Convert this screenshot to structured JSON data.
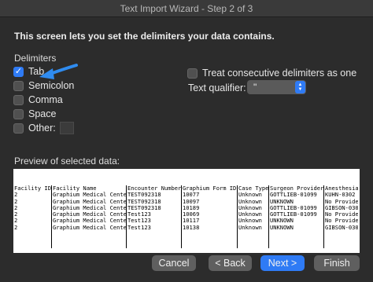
{
  "window": {
    "title": "Text Import Wizard - Step 2 of 3"
  },
  "instructions": "This screen lets you set the delimiters your data contains.",
  "delimiters": {
    "label": "Delimiters",
    "tab": {
      "label": "Tab",
      "checked": true
    },
    "semicolon": {
      "label": "Semicolon",
      "checked": false
    },
    "comma": {
      "label": "Comma",
      "checked": false
    },
    "space": {
      "label": "Space",
      "checked": false
    },
    "other": {
      "label": "Other:",
      "checked": false,
      "value": ""
    }
  },
  "options": {
    "consecutive": {
      "label": "Treat consecutive delimiters as one",
      "checked": false
    },
    "qualifier_label": "Text qualifier:",
    "qualifier_value": "\""
  },
  "preview": {
    "label": "Preview of selected data:",
    "columns": [
      {
        "cells": [
          "Facility ID",
          "2",
          "2",
          "2",
          "2",
          "2",
          "2"
        ]
      },
      {
        "cells": [
          "Facility Name",
          "Graphium Medical Center",
          "Graphium Medical Center",
          "Graphium Medical Center",
          "Graphium Medical Center",
          "Graphium Medical Center",
          "Graphium Medical Center"
        ]
      },
      {
        "cells": [
          "Encounter Number",
          "TEST092318",
          "TEST092318",
          "TEST092318",
          "Test123",
          "Test123",
          "Test123"
        ]
      },
      {
        "cells": [
          "Graphium Form ID",
          "10077",
          "10097",
          "10189",
          "10069",
          "10117",
          "10138"
        ]
      },
      {
        "cells": [
          "Case Type",
          "Unknown",
          "Unknown",
          "Unknown",
          "Unknown",
          "Unknown",
          "Unknown"
        ]
      },
      {
        "cells": [
          "Surgeon Provider",
          "GOTTLIEB-01099",
          "UNKNOWN",
          "GOTTLIEB-01099",
          "GOTTLIEB-01099",
          "UNKNOWN",
          "UNKNOWN"
        ]
      },
      {
        "cells": [
          "Anesthesia",
          "KUHN-0302",
          "No Provide",
          "GIBSON-030",
          "No Provide",
          "No Provide",
          "GIBSON-030"
        ]
      }
    ]
  },
  "buttons": {
    "cancel": "Cancel",
    "back": "< Back",
    "next": "Next >",
    "finish": "Finish"
  },
  "colors": {
    "accent": "#2f7bf5",
    "background": "#2c2c2c",
    "button": "#5f5f5f"
  }
}
